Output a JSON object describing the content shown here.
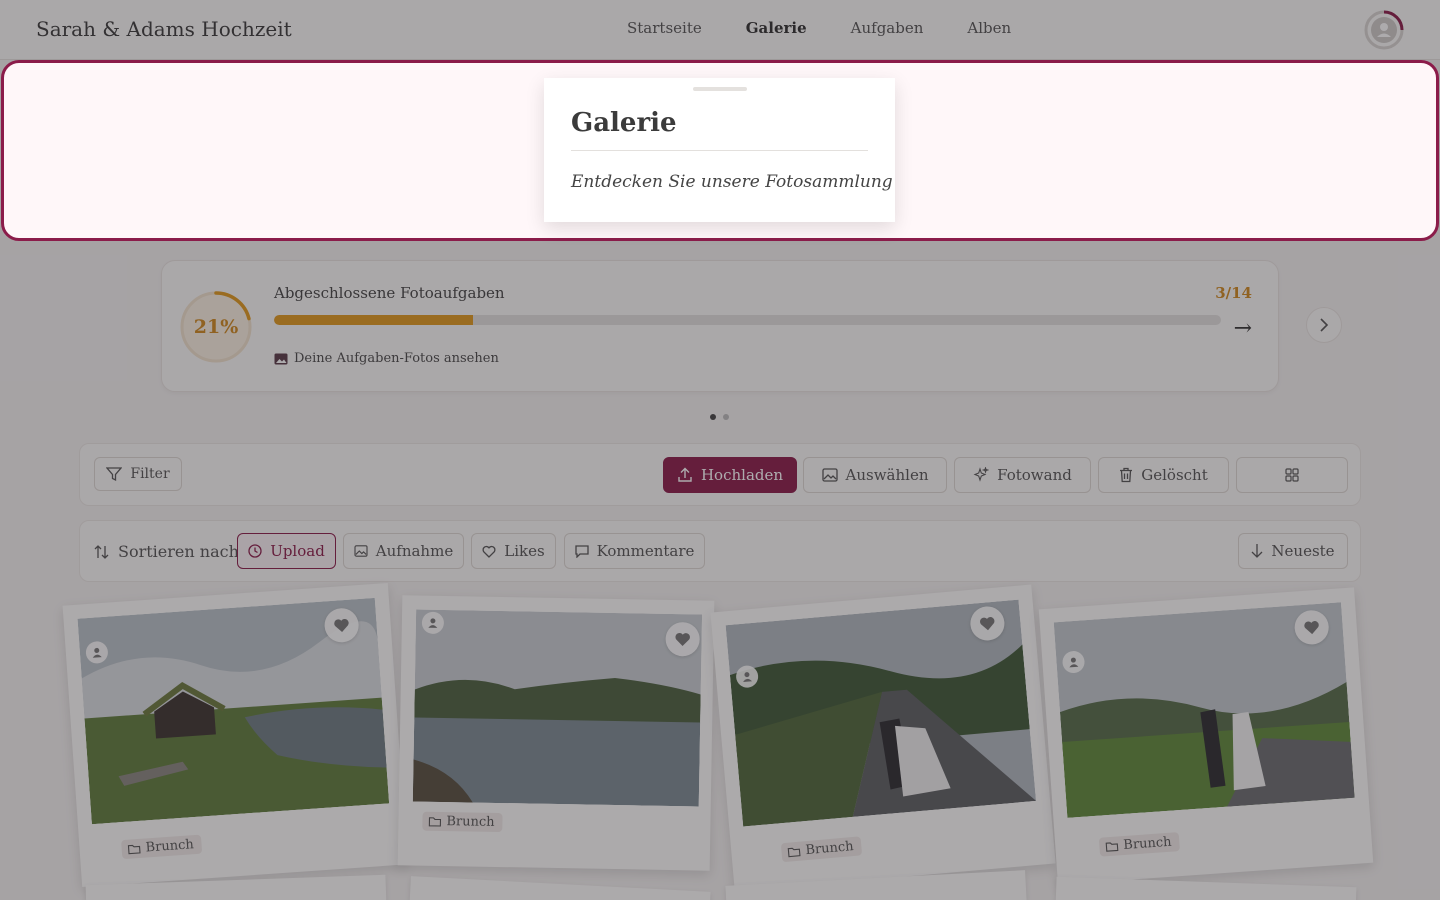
{
  "brand": "Sarah & Adams Hochzeit",
  "nav": [
    {
      "label": "Startseite",
      "active": false
    },
    {
      "label": "Galerie",
      "active": true
    },
    {
      "label": "Aufgaben",
      "active": false
    },
    {
      "label": "Alben",
      "active": false
    }
  ],
  "progress": {
    "percent_label": "21%",
    "percent": 21,
    "title": "Abgeschlossene Fotoaufgaben",
    "count": "3/14",
    "link": "Deine Aufgaben-Fotos ansehen"
  },
  "carousel": {
    "dots": 2,
    "active": 0
  },
  "toolbar": {
    "filter": "Filter",
    "upload": "Hochladen",
    "select": "Auswählen",
    "photowall": "Fotowand",
    "deleted": "Gelöscht"
  },
  "sort": {
    "label": "Sortieren nach",
    "options": [
      "Upload",
      "Aufnahme",
      "Likes",
      "Kommentare"
    ],
    "selected": "Upload",
    "order": "Neueste"
  },
  "photos": [
    {
      "tag": "Brunch",
      "scene": "cabin-lake"
    },
    {
      "tag": "Brunch",
      "scene": "lake"
    },
    {
      "tag": "Brunch",
      "scene": "couple-road"
    },
    {
      "tag": "Brunch",
      "scene": "couple-walk"
    }
  ],
  "tooltip": {
    "title": "Galerie",
    "text": "Entdecken Sie unsere Fotosammlung"
  },
  "colors": {
    "accent": "#8b1c4a",
    "progress": "#e09a1e"
  }
}
